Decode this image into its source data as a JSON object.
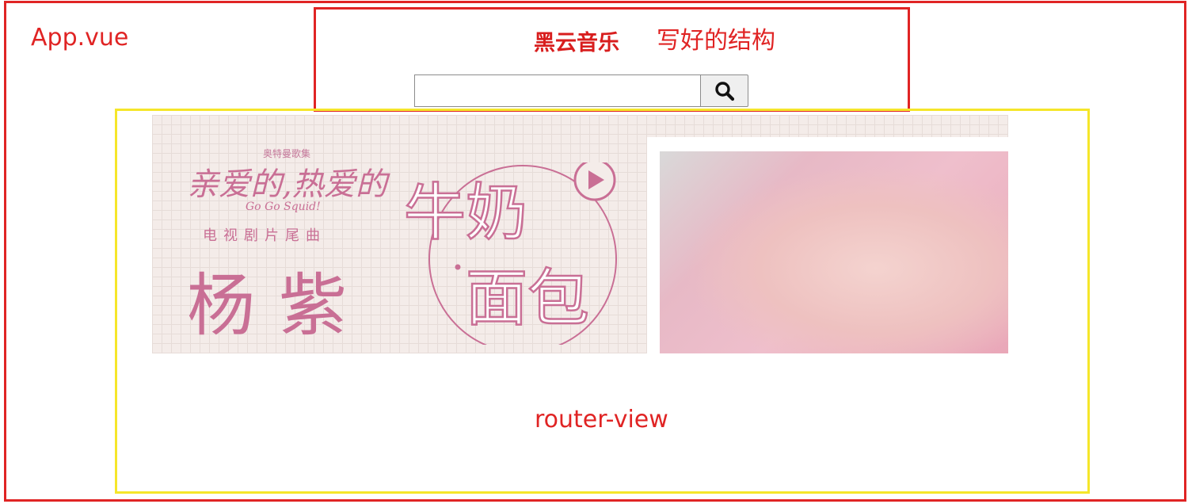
{
  "app": {
    "label": "App.vue",
    "frame_color": "#e02424"
  },
  "header": {
    "brand": "黑云音乐",
    "note": "写好的结构",
    "search": {
      "value": "",
      "placeholder": ""
    },
    "search_icon": "search-icon",
    "brand_color": "#d81e1e"
  },
  "router_view": {
    "label": "router-view",
    "frame_color": "#f5e62a"
  },
  "banner": {
    "kicker": "奥特曼歌集",
    "drama_title": "亲爱的,热爱的",
    "english_title": "Go Go Squid!",
    "subtitle": "电视剧片尾曲",
    "singer": "杨紫",
    "song_title_line1": "牛奶",
    "song_title_line2": "面包",
    "play_icon": "play-icon",
    "accent_color": "#c96f95"
  }
}
